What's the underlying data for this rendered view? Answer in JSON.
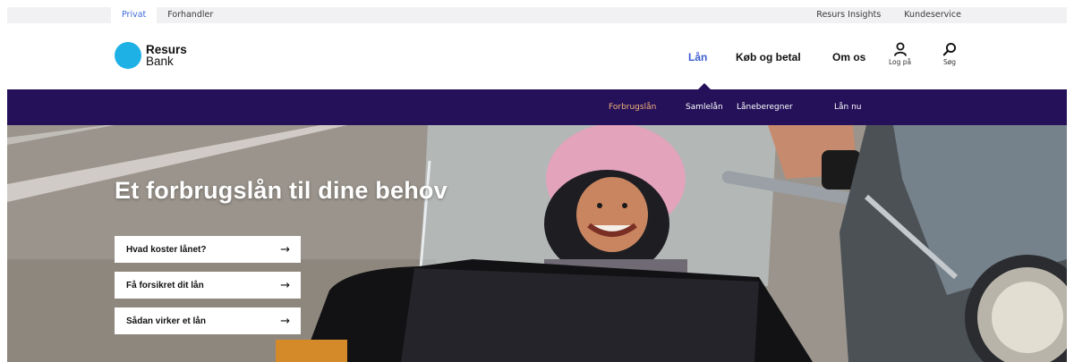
{
  "utility": {
    "tabs": [
      {
        "label": "Privat",
        "active": true
      },
      {
        "label": "Forhandler",
        "active": false
      }
    ],
    "links": [
      "Resurs Insights",
      "Kundeservice"
    ]
  },
  "brand": {
    "name_line1": "Resurs",
    "name_line2": "Bank",
    "logo_color": "#1eb1e6"
  },
  "main_nav": {
    "items": [
      {
        "label": "Lån",
        "active": true
      },
      {
        "label": "Køb og betal",
        "active": false
      },
      {
        "label": "Om os",
        "active": false
      }
    ],
    "login_label": "Log på",
    "search_label": "Søg",
    "login_icon": "user-icon",
    "search_icon": "search-icon"
  },
  "sub_nav": {
    "items": [
      {
        "label": "Forbrugslån",
        "active": true
      },
      {
        "label": "Samlelån",
        "active": false
      },
      {
        "label": "Låneberegner",
        "active": false
      },
      {
        "label": "Lån nu",
        "active": false
      }
    ],
    "background": "#24115a",
    "active_color": "#f3b37a"
  },
  "hero": {
    "title": "Et forbrugslån til dine behov",
    "ctas": [
      {
        "label": "Hvad koster lånet?"
      },
      {
        "label": "Få forsikret dit lån"
      },
      {
        "label": "Sådan virker et lån"
      }
    ],
    "arrow": "→"
  }
}
